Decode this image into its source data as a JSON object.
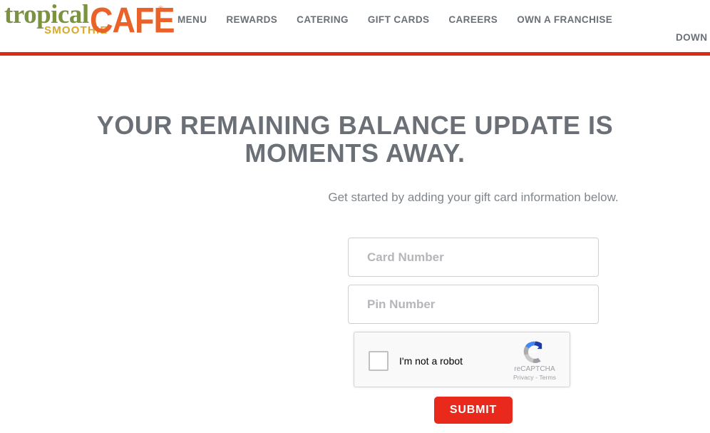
{
  "header": {
    "logo": {
      "word1": "tropical",
      "word2": "SMOOTHIE",
      "word3": "CAFE",
      "trademark": "®",
      "color_green": "#7b9240",
      "color_gold": "#d8a82b",
      "color_orange": "#e8622a"
    },
    "nav": [
      {
        "label": "MENU"
      },
      {
        "label": "REWARDS"
      },
      {
        "label": "CATERING"
      },
      {
        "label": "GIFT CARDS"
      },
      {
        "label": "CAREERS"
      },
      {
        "label": "OWN A FRANCHISE"
      }
    ],
    "utility_link": "DOWN",
    "rule_color": "#dc2b18"
  },
  "main": {
    "heading": "YOUR REMAINING BALANCE UPDATE IS\nMOMENTS AWAY.",
    "subheading": "Get started by adding your gift card information below.",
    "form": {
      "card_number": {
        "value": "",
        "placeholder": "Card Number"
      },
      "pin_number": {
        "value": "",
        "placeholder": "Pin Number"
      },
      "recaptcha": {
        "label": "I'm not a robot",
        "brand": "reCAPTCHA",
        "privacy": "Privacy",
        "separator": "-",
        "terms": "Terms",
        "checked": false
      },
      "submit_label": "SUBMIT",
      "submit_color": "#e8291c"
    }
  }
}
